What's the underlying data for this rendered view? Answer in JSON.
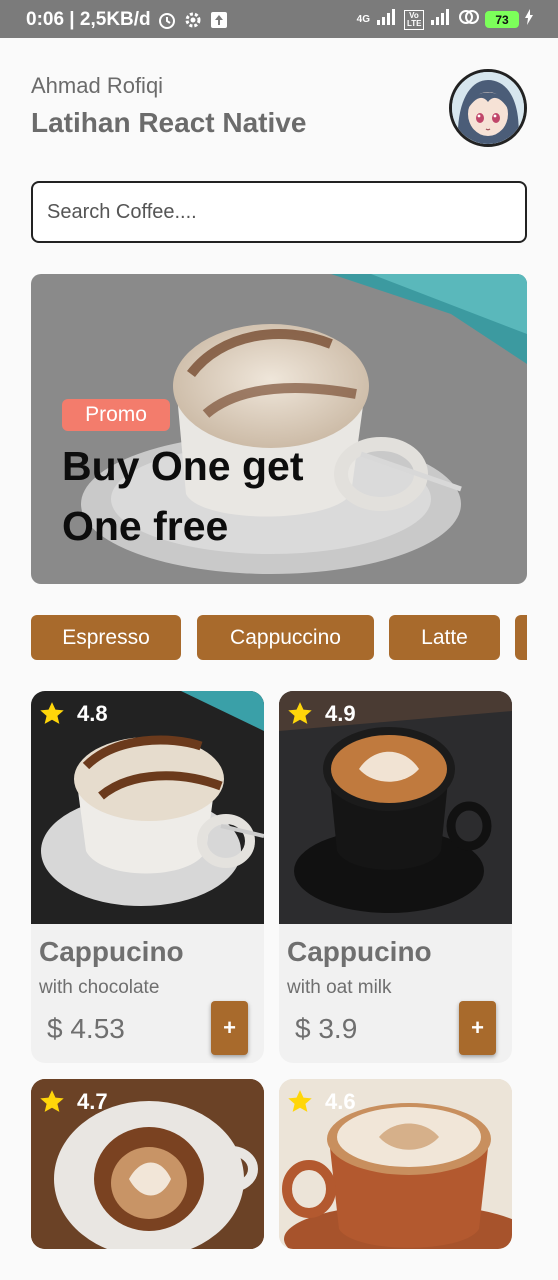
{
  "status_bar": {
    "time_speed": "0:06 | 2,5KB/d",
    "network": "4G",
    "volte": "Vo LTE",
    "battery": "73",
    "icons": [
      "alarm-icon",
      "gear-icon",
      "upload-icon",
      "signal-icon",
      "hotspot-icon",
      "charging-icon"
    ]
  },
  "header": {
    "greeting": "Ahmad Rofiqi",
    "title": "Latihan React Native"
  },
  "search": {
    "placeholder": "Search Coffee...."
  },
  "promo": {
    "badge": "Promo",
    "headline": "Buy One get One free"
  },
  "categories": [
    "Espresso",
    "Cappuccino",
    "Latte",
    ""
  ],
  "products": [
    {
      "rating": "4.8",
      "name": "Cappucino",
      "description": "with chocolate",
      "price": "$ 4.53",
      "add": "+"
    },
    {
      "rating": "4.9",
      "name": "Cappucino",
      "description": "with oat milk",
      "price": "$ 3.9",
      "add": "+"
    },
    {
      "rating": "4.7",
      "name": "",
      "description": "",
      "price": "",
      "add": ""
    },
    {
      "rating": "4.6",
      "name": "",
      "description": "",
      "price": "",
      "add": ""
    }
  ],
  "colors": {
    "accent": "#a86a2c",
    "promo_badge": "#f37c6c",
    "star": "#ffd60a",
    "text_muted": "#6f6f6f",
    "status_bar": "#7b7b7b"
  }
}
